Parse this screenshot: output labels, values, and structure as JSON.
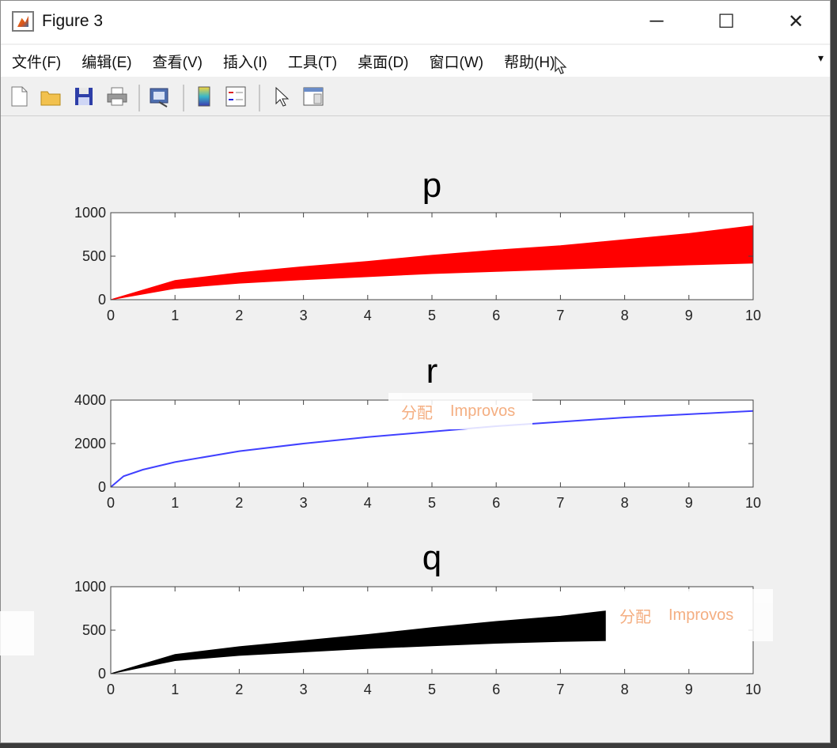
{
  "window": {
    "title": "Figure 3",
    "minimize_glyph": "─",
    "maximize_glyph": "☐",
    "close_glyph": "✕"
  },
  "menu": {
    "items": [
      "文件(F)",
      "编辑(E)",
      "查看(V)",
      "插入(I)",
      "工具(T)",
      "桌面(D)",
      "窗口(W)",
      "帮助(H)"
    ],
    "overflow_glyph": "▾"
  },
  "toolbar": {
    "icons": [
      "new-figure-icon",
      "open-file-icon",
      "save-icon",
      "print-icon",
      "link-plot-icon",
      "insert-colorbar-icon",
      "insert-legend-icon",
      "edit-plot-arrow-icon",
      "property-inspector-icon"
    ]
  },
  "overlays": [
    {
      "left_text": "分配",
      "right_text": "Improvos"
    },
    {
      "left_text": "分配",
      "right_text": "Improvos"
    }
  ],
  "colors": {
    "p": "#ff0000",
    "r": "#0000ff",
    "q": "#000000"
  },
  "chart_data": [
    {
      "type": "area",
      "title": "p",
      "xlim": [
        0,
        10
      ],
      "ylim": [
        0,
        1000
      ],
      "xticks": [
        0,
        1,
        2,
        3,
        4,
        5,
        6,
        7,
        8,
        9,
        10
      ],
      "yticks": [
        0,
        500,
        1000
      ],
      "series": [
        {
          "band_x": [
            0,
            1,
            2,
            3,
            4,
            5,
            6,
            7,
            8,
            9,
            10
          ],
          "lower": [
            0,
            130,
            190,
            230,
            265,
            300,
            325,
            350,
            375,
            400,
            420
          ],
          "upper": [
            0,
            220,
            310,
            380,
            440,
            510,
            570,
            620,
            690,
            760,
            850
          ]
        }
      ]
    },
    {
      "type": "line",
      "title": "r",
      "xlim": [
        0,
        10
      ],
      "ylim": [
        0,
        4000
      ],
      "xticks": [
        0,
        1,
        2,
        3,
        4,
        5,
        6,
        7,
        8,
        9,
        10
      ],
      "yticks": [
        0,
        2000,
        4000
      ],
      "series": [
        {
          "x": [
            0,
            0.2,
            0.5,
            1,
            2,
            3,
            4,
            5,
            6,
            7,
            8,
            9,
            10
          ],
          "y": [
            0,
            500,
            800,
            1150,
            1650,
            2000,
            2300,
            2550,
            2800,
            3000,
            3200,
            3350,
            3500
          ]
        }
      ]
    },
    {
      "type": "area",
      "title": "q",
      "xlim": [
        0,
        10
      ],
      "ylim": [
        0,
        1000
      ],
      "xticks": [
        0,
        1,
        2,
        3,
        4,
        5,
        6,
        7,
        8,
        9,
        10
      ],
      "yticks": [
        0,
        500,
        1000
      ],
      "series": [
        {
          "band_x": [
            0,
            1,
            2,
            3,
            4,
            5,
            6,
            7,
            7.7
          ],
          "lower": [
            0,
            150,
            210,
            250,
            290,
            320,
            350,
            370,
            380
          ],
          "upper": [
            0,
            220,
            310,
            380,
            450,
            530,
            600,
            660,
            720
          ]
        }
      ]
    }
  ]
}
